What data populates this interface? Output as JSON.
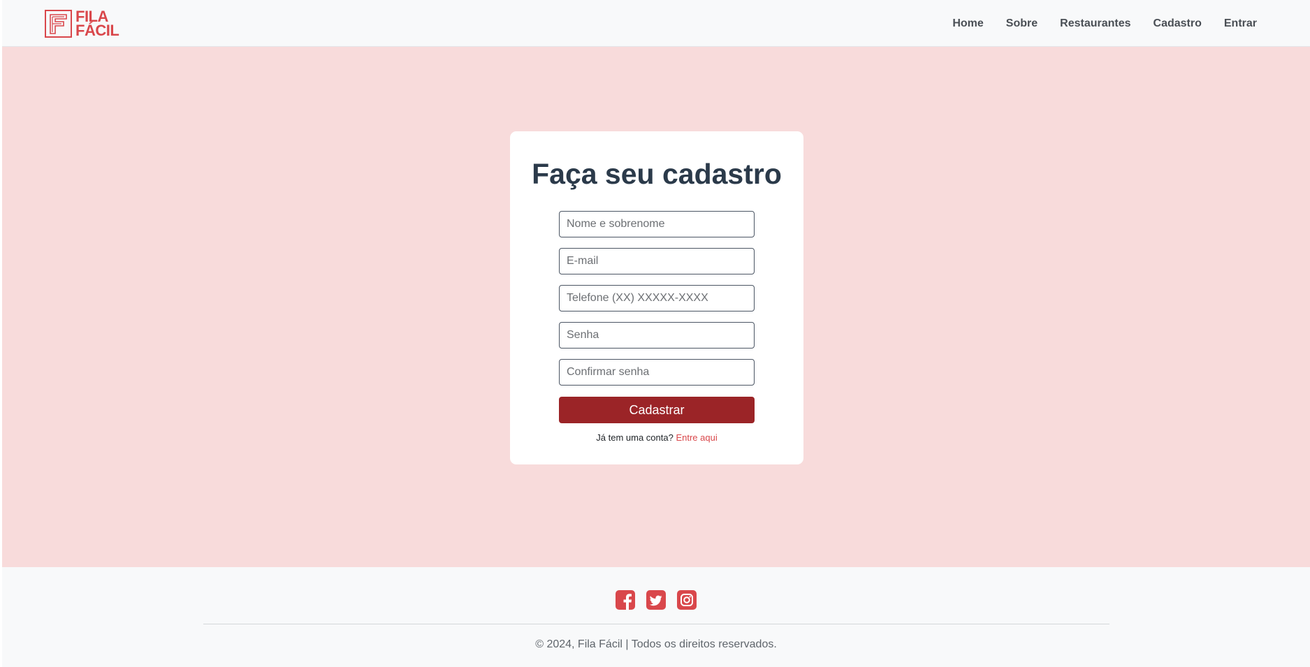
{
  "brand": {
    "line1": "FILA",
    "line2": "FÁCIL",
    "color": "#d9474b"
  },
  "nav": {
    "items": [
      {
        "label": "Home"
      },
      {
        "label": "Sobre"
      },
      {
        "label": "Restaurantes"
      },
      {
        "label": "Cadastro"
      },
      {
        "label": "Entrar"
      }
    ]
  },
  "form": {
    "title": "Faça seu cadastro",
    "fields": [
      {
        "placeholder": "Nome e sobrenome",
        "value": ""
      },
      {
        "placeholder": "E-mail",
        "value": ""
      },
      {
        "placeholder": "Telefone (XX) XXXXX-XXXX",
        "value": ""
      },
      {
        "placeholder": "Senha",
        "value": ""
      },
      {
        "placeholder": "Confirmar senha",
        "value": ""
      }
    ],
    "submit_label": "Cadastrar",
    "login_prompt": "Já tem uma conta?",
    "login_link": "Entre aqui"
  },
  "footer": {
    "social": [
      {
        "icon": "facebook-icon"
      },
      {
        "icon": "twitter-icon"
      },
      {
        "icon": "instagram-icon"
      }
    ],
    "copyright": "© 2024, Fila Fácil | Todos os direitos reservados."
  },
  "colors": {
    "accent": "#d9474b",
    "button": "#9b2427",
    "main_bg": "#f8dbdb",
    "nav_bg": "#f8f9fa"
  }
}
